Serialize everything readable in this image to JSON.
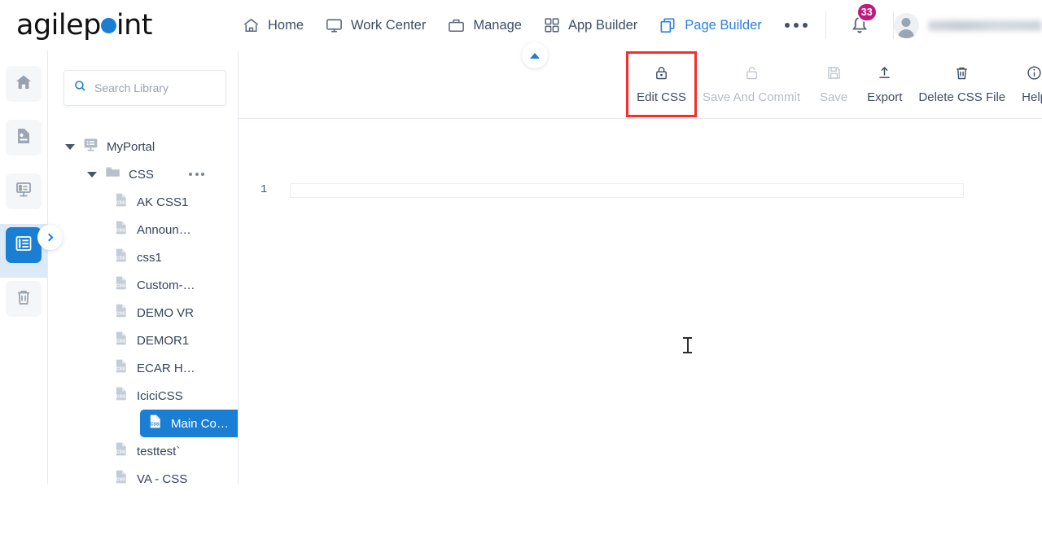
{
  "app": {
    "logo_before": "agilep",
    "logo_dot": "o",
    "logo_after": "int"
  },
  "topnav": {
    "items": [
      {
        "label": "Home",
        "icon": "home-icon",
        "active": false
      },
      {
        "label": "Work Center",
        "icon": "monitor-icon",
        "active": false
      },
      {
        "label": "Manage",
        "icon": "briefcase-icon",
        "active": false
      },
      {
        "label": "App Builder",
        "icon": "grid-icon",
        "active": false
      },
      {
        "label": "Page Builder",
        "icon": "copy-pages-icon",
        "active": true
      }
    ],
    "more_label": "more-options",
    "notification_count": "33",
    "username": "",
    "accent_active": "#2a7fe0",
    "badge_color": "#c21a7a"
  },
  "rail": {
    "items": [
      {
        "name": "home",
        "icon": "home-icon",
        "active": false
      },
      {
        "name": "pages",
        "icon": "page-icon",
        "active": false
      },
      {
        "name": "forms",
        "icon": "form-icon",
        "active": false
      },
      {
        "name": "library",
        "icon": "library-icon",
        "active": true
      },
      {
        "name": "recycle-bin",
        "icon": "trash-icon",
        "active": false
      }
    ],
    "expand_label": "expand-panel"
  },
  "library": {
    "search": {
      "placeholder": "Search Library",
      "value": ""
    },
    "tree": [
      {
        "label": "MyPortal",
        "icon": "portal-icon",
        "level": 0,
        "expanded": true,
        "selected": false,
        "menu": false
      },
      {
        "label": "CSS",
        "icon": "folder-icon",
        "level": 1,
        "expanded": true,
        "selected": false,
        "menu": true
      },
      {
        "label": "AK CSS1",
        "icon": "css-file-icon",
        "level": 2,
        "selected": false,
        "menu": false
      },
      {
        "label": "Announ…",
        "icon": "css-file-icon",
        "level": 2,
        "selected": false,
        "menu": false
      },
      {
        "label": "css1",
        "icon": "css-file-icon",
        "level": 2,
        "selected": false,
        "menu": false
      },
      {
        "label": "Custom-…",
        "icon": "css-file-icon",
        "level": 2,
        "selected": false,
        "menu": false
      },
      {
        "label": "DEMO VR",
        "icon": "css-file-icon",
        "level": 2,
        "selected": false,
        "menu": false
      },
      {
        "label": "DEMOR1",
        "icon": "css-file-icon",
        "level": 2,
        "selected": false,
        "menu": false
      },
      {
        "label": "ECAR H…",
        "icon": "css-file-icon",
        "level": 2,
        "selected": false,
        "menu": false
      },
      {
        "label": "IciciCSS",
        "icon": "css-file-icon",
        "level": 2,
        "selected": false,
        "menu": false
      },
      {
        "label": "Main Co…",
        "icon": "css-file-icon",
        "level": 2,
        "selected": true,
        "menu": false
      },
      {
        "label": "testtest`",
        "icon": "css-file-icon",
        "level": 2,
        "selected": false,
        "menu": false
      },
      {
        "label": "VA - CSS",
        "icon": "css-file-icon",
        "level": 2,
        "selected": false,
        "menu": false
      }
    ],
    "selected_color": "#1a7fd4"
  },
  "toolbar": {
    "buttons": [
      {
        "label": "Edit CSS",
        "icon": "lock-closed-icon",
        "disabled": false,
        "highlighted": true
      },
      {
        "label": "Save And Commit",
        "icon": "lock-open-icon",
        "disabled": true,
        "highlighted": false
      },
      {
        "label": "Save",
        "icon": "floppy-disk-icon",
        "disabled": true,
        "highlighted": false
      },
      {
        "label": "Export",
        "icon": "upload-icon",
        "disabled": false,
        "highlighted": false
      },
      {
        "label": "Delete CSS File",
        "icon": "trash-icon",
        "disabled": false,
        "highlighted": false
      },
      {
        "label": "Help",
        "icon": "info-circle-icon",
        "disabled": false,
        "highlighted": false
      }
    ],
    "highlight_color": "#fb2c2c"
  },
  "editor": {
    "line_numbers": [
      "1"
    ],
    "lines": [
      ""
    ]
  }
}
